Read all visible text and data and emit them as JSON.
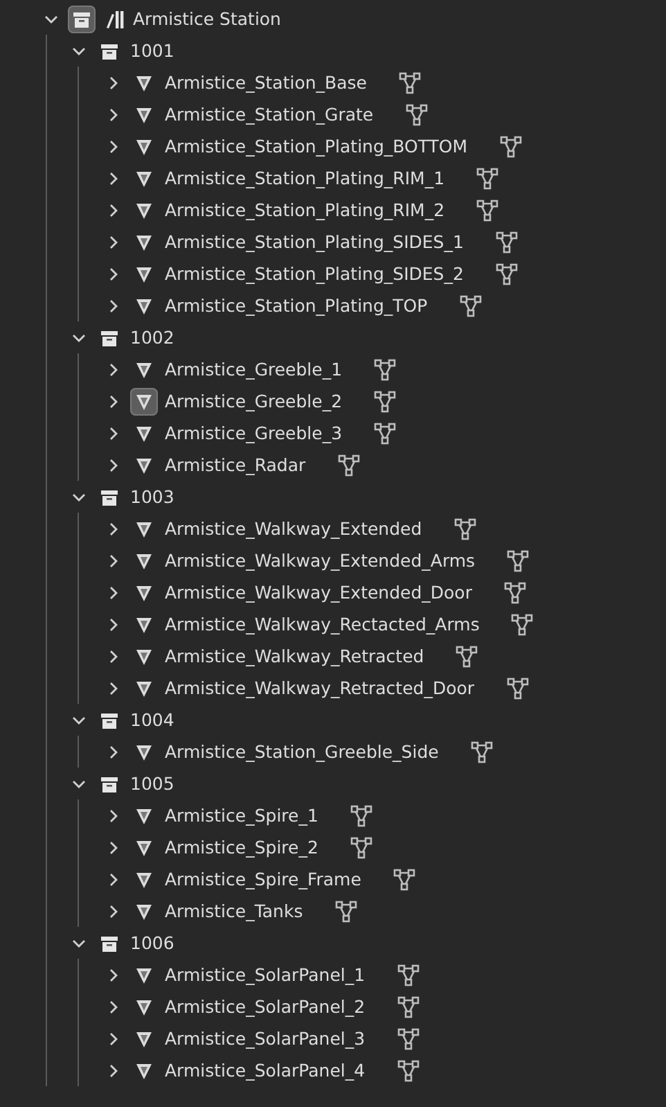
{
  "outliner": {
    "name": "Armistice Station",
    "expanded": true,
    "active": true,
    "collections": [
      {
        "name": "1001",
        "expanded": true,
        "active": false,
        "objects": [
          {
            "name": "Armistice_Station_Base",
            "expanded": false,
            "active": false
          },
          {
            "name": "Armistice_Station_Grate",
            "expanded": false,
            "active": false
          },
          {
            "name": "Armistice_Station_Plating_BOTTOM",
            "expanded": false,
            "active": false
          },
          {
            "name": "Armistice_Station_Plating_RIM_1",
            "expanded": false,
            "active": false
          },
          {
            "name": "Armistice_Station_Plating_RIM_2",
            "expanded": false,
            "active": false
          },
          {
            "name": "Armistice_Station_Plating_SIDES_1",
            "expanded": false,
            "active": false
          },
          {
            "name": "Armistice_Station_Plating_SIDES_2",
            "expanded": false,
            "active": false
          },
          {
            "name": "Armistice_Station_Plating_TOP",
            "expanded": false,
            "active": false
          }
        ]
      },
      {
        "name": "1002",
        "expanded": true,
        "active": false,
        "objects": [
          {
            "name": "Armistice_Greeble_1",
            "expanded": false,
            "active": false
          },
          {
            "name": "Armistice_Greeble_2",
            "expanded": false,
            "active": true
          },
          {
            "name": "Armistice_Greeble_3",
            "expanded": false,
            "active": false
          },
          {
            "name": "Armistice_Radar",
            "expanded": false,
            "active": false
          }
        ]
      },
      {
        "name": "1003",
        "expanded": true,
        "active": false,
        "objects": [
          {
            "name": "Armistice_Walkway_Extended",
            "expanded": false,
            "active": false
          },
          {
            "name": "Armistice_Walkway_Extended_Arms",
            "expanded": false,
            "active": false
          },
          {
            "name": "Armistice_Walkway_Extended_Door",
            "expanded": false,
            "active": false
          },
          {
            "name": "Armistice_Walkway_Rectacted_Arms",
            "expanded": false,
            "active": false
          },
          {
            "name": "Armistice_Walkway_Retracted",
            "expanded": false,
            "active": false
          },
          {
            "name": "Armistice_Walkway_Retracted_Door",
            "expanded": false,
            "active": false
          }
        ]
      },
      {
        "name": "1004",
        "expanded": true,
        "active": false,
        "objects": [
          {
            "name": "Armistice_Station_Greeble_Side",
            "expanded": false,
            "active": false
          }
        ]
      },
      {
        "name": "1005",
        "expanded": true,
        "active": false,
        "objects": [
          {
            "name": "Armistice_Spire_1",
            "expanded": false,
            "active": false
          },
          {
            "name": "Armistice_Spire_2",
            "expanded": false,
            "active": false
          },
          {
            "name": "Armistice_Spire_Frame",
            "expanded": false,
            "active": false
          },
          {
            "name": "Armistice_Tanks",
            "expanded": false,
            "active": false
          }
        ]
      },
      {
        "name": "1006",
        "expanded": true,
        "active": false,
        "objects": [
          {
            "name": "Armistice_SolarPanel_1",
            "expanded": false,
            "active": false
          },
          {
            "name": "Armistice_SolarPanel_2",
            "expanded": false,
            "active": false
          },
          {
            "name": "Armistice_SolarPanel_3",
            "expanded": false,
            "active": false
          },
          {
            "name": "Armistice_SolarPanel_4",
            "expanded": false,
            "active": false
          }
        ]
      }
    ]
  }
}
